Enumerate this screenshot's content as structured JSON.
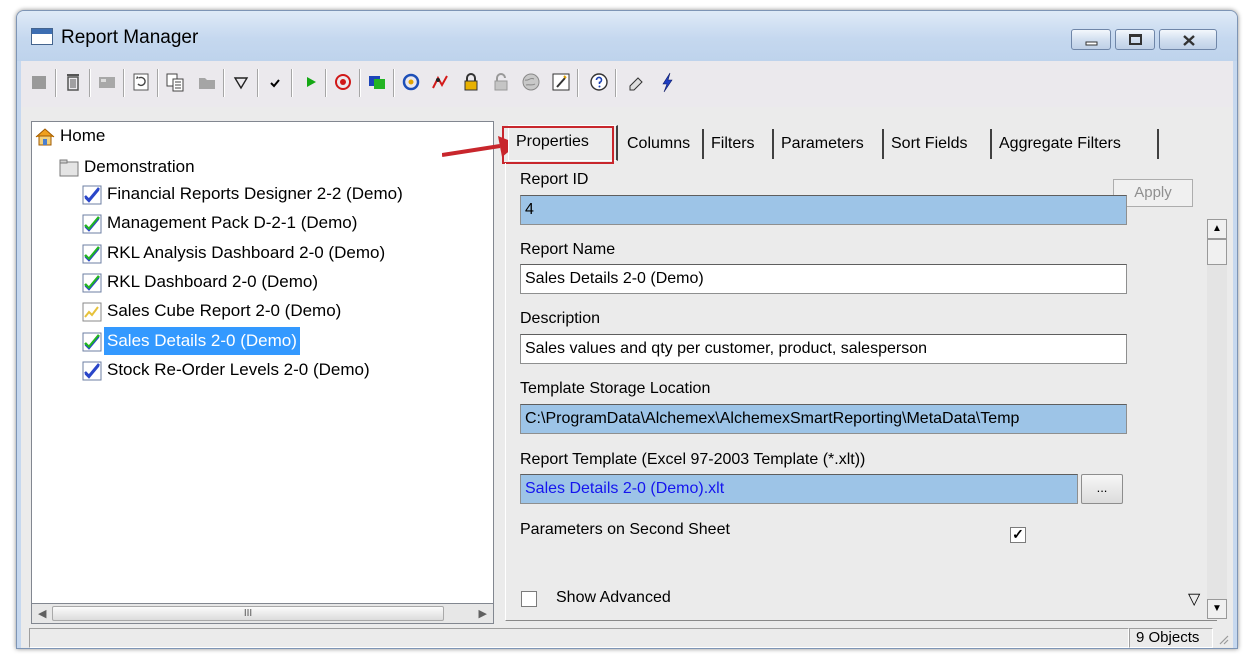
{
  "window": {
    "title": "Report Manager",
    "icon": "app-window-icon",
    "controls": [
      "minimize-icon",
      "maximize-icon",
      "close-icon"
    ]
  },
  "toolbar": {
    "buttons": [
      "new-report-icon",
      "delete-icon",
      "disabled-icon",
      "refresh-icon",
      "copy-icon",
      "disabled-folder-icon",
      "filter-icon",
      "check-icon",
      "run-icon",
      "stop-icon",
      "window-icon",
      "sync-icon",
      "chart-icon",
      "lock-icon",
      "unlock-icon",
      "globe-icon",
      "wizard-icon",
      "help-icon",
      "pen-icon",
      "lightning-icon"
    ]
  },
  "tree": {
    "root": "Home",
    "folder": "Demonstration",
    "items": [
      {
        "label": "Financial Reports Designer 2-2 (Demo)",
        "icon": "checked-report-icon"
      },
      {
        "label": "Management Pack D-2-1 (Demo)",
        "icon": "checked-report-icon"
      },
      {
        "label": "RKL Analysis Dashboard 2-0 (Demo)",
        "icon": "checked-report-icon"
      },
      {
        "label": "RKL Dashboard 2-0 (Demo)",
        "icon": "checked-report-icon"
      },
      {
        "label": "Sales Cube Report 2-0 (Demo)",
        "icon": "chart-report-icon"
      },
      {
        "label": "Sales Details 2-0 (Demo)",
        "icon": "checked-report-icon",
        "selected": true
      },
      {
        "label": "Stock Re-Order Levels 2-0 (Demo)",
        "icon": "checked-report-icon"
      }
    ],
    "scroll_grip": "III"
  },
  "tabs": {
    "items": [
      "Properties",
      "Columns",
      "Filters",
      "Parameters",
      "Sort Fields",
      "Aggregate Filters"
    ],
    "active": "Properties"
  },
  "form": {
    "apply_label": "Apply",
    "report_id_label": "Report ID",
    "report_id_value": "4",
    "report_name_label": "Report Name",
    "report_name_value": "Sales Details 2-0 (Demo)",
    "description_label": "Description",
    "description_value": "Sales values and qty per customer, product, salesperson",
    "template_location_label": "Template Storage Location",
    "template_location_value": "C:\\ProgramData\\Alchemex\\AlchemexSmartReporting\\MetaData\\Temp",
    "report_template_label": "Report Template (Excel 97-2003 Template (*.xlt))",
    "report_template_value": "Sales Details 2-0 (Demo).xlt",
    "browse_label": "...",
    "params_second_sheet_label": "Parameters on Second Sheet",
    "params_second_sheet_checked": true,
    "show_advanced_label": "Show Advanced",
    "show_advanced_checked": false,
    "check_mark": "✓"
  },
  "status": {
    "count": "9 Objects"
  },
  "colors": {
    "selection": "#3399ff",
    "readonly_field": "#9dc4e7",
    "annotation": "#c8262c"
  }
}
